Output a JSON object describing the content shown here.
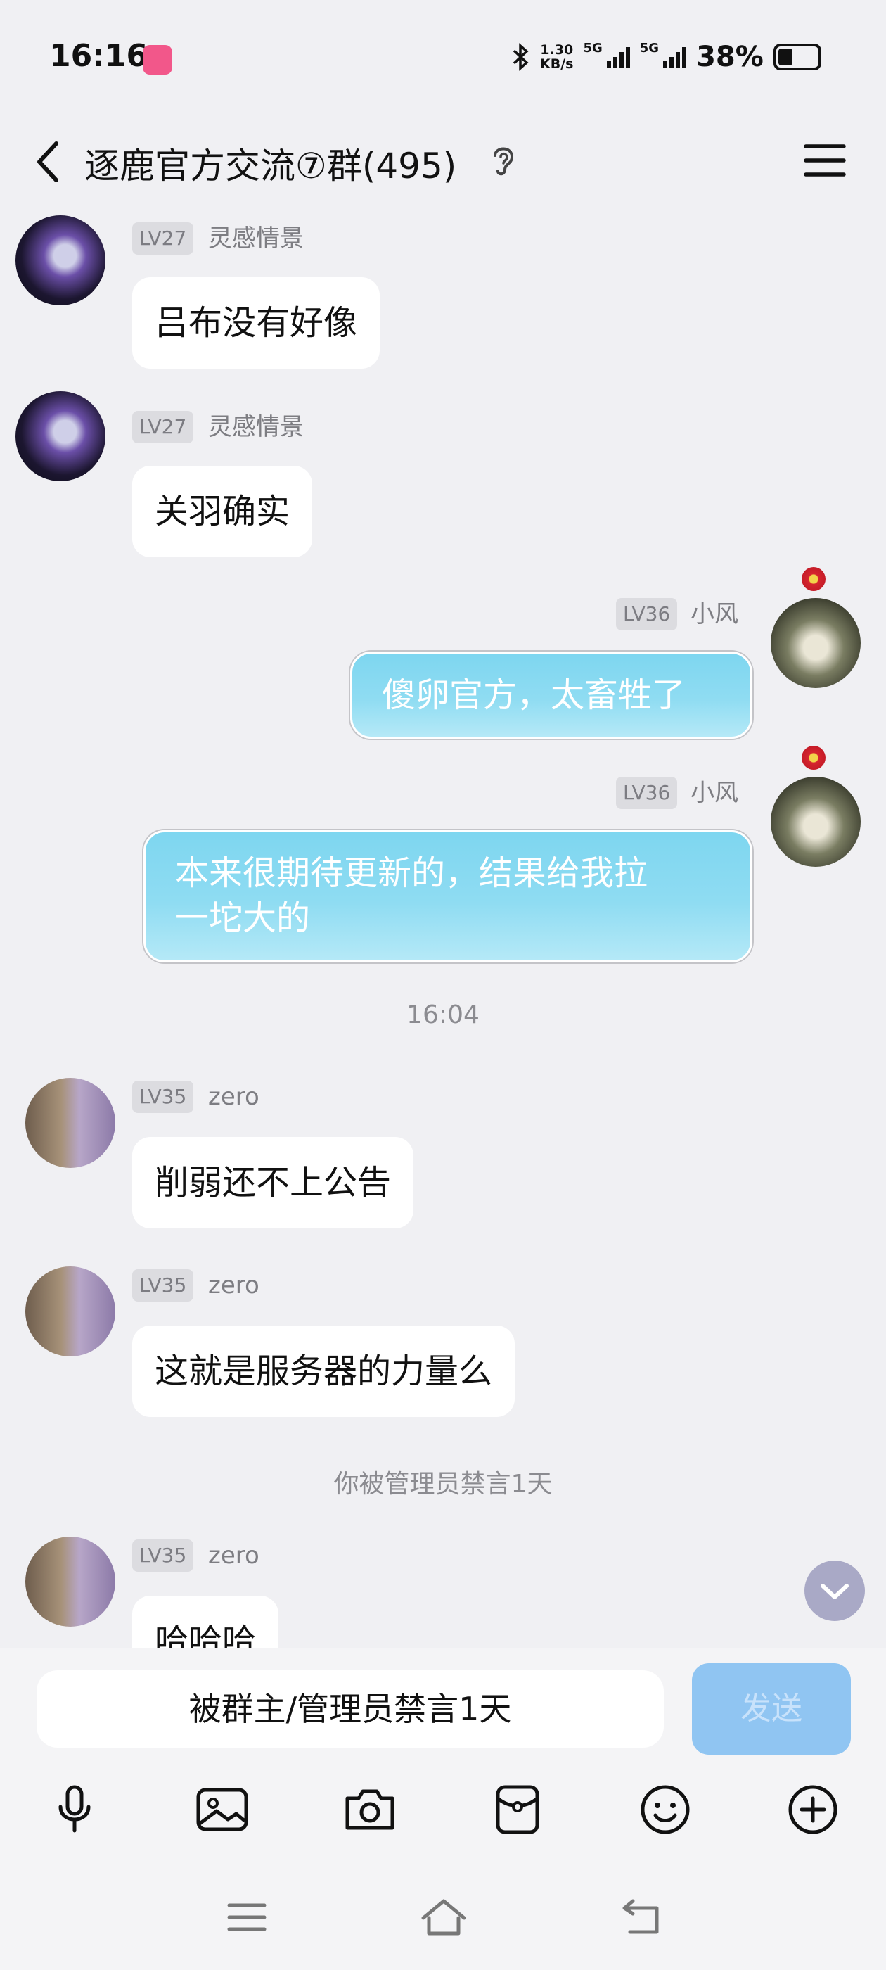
{
  "status_bar": {
    "time": "16:16",
    "net_speed_value": "1.30",
    "net_speed_unit": "KB/s",
    "signal_label_1": "5G",
    "signal_label_2": "5G",
    "battery_percent": "38%",
    "battery_level": 0.38
  },
  "header": {
    "title": "逐鹿官方交流⑦群(495)"
  },
  "messages": [
    {
      "side": "left",
      "level": "LV27",
      "nickname": "灵感情景",
      "text": "吕布没有好像",
      "avatar": "dark-armor-avatar"
    },
    {
      "side": "left",
      "level": "LV27",
      "nickname": "灵感情景",
      "text": "关羽确实",
      "avatar": "dark-armor-avatar"
    },
    {
      "side": "right",
      "level": "LV36",
      "nickname": "小风",
      "text": "傻卵官方，太畜牲了",
      "avatar": "fox-avatar"
    },
    {
      "side": "right",
      "level": "LV36",
      "nickname": "小风",
      "text_line1": "本来很期待更新的，结果给我拉",
      "text_line2": "一坨大的",
      "avatar": "fox-avatar"
    },
    {
      "side": "left",
      "level": "LV35",
      "nickname": "zero",
      "text": "削弱还不上公告",
      "avatar": "couple-avatar"
    },
    {
      "side": "left",
      "level": "LV35",
      "nickname": "zero",
      "text": "这就是服务器的力量么",
      "avatar": "couple-avatar"
    },
    {
      "side": "left",
      "level": "LV35",
      "nickname": "zero",
      "text": "哈哈哈",
      "avatar": "couple-avatar"
    }
  ],
  "timestamp": "16:04",
  "system_message": "你被管理员禁言1天",
  "input": {
    "muted_text": "被群主/管理员禁言1天",
    "send_label": "发送"
  },
  "toolbar_icons": [
    "microphone-icon",
    "image-icon",
    "camera-icon",
    "red-packet-icon",
    "emoji-icon",
    "plus-icon"
  ],
  "nav_icons": [
    "menu-icon",
    "home-icon",
    "back-icon"
  ],
  "colors": {
    "background": "#f0f0f3",
    "bubble_self": "#86d8f1",
    "send_button": "#90c5f2",
    "level_badge": "#dcdce0"
  }
}
